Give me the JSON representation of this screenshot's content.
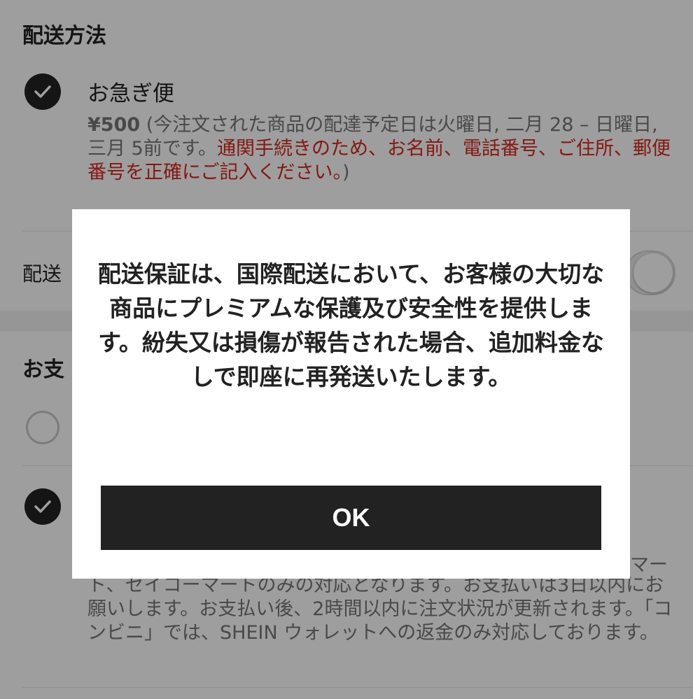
{
  "shipping": {
    "title": "配送方法",
    "option_name": "お急ぎ便",
    "price": "¥500",
    "desc_normal": " (今注文された商品の配達予定日は火曜日, 二月 28 – 日曜日, 三月 5前です。",
    "desc_warning": "通関手続きのため、お名前、電話番号、ご住所、郵便番号を正確にご記入ください。",
    "desc_end": ")",
    "guarantee_label": "配送"
  },
  "payment": {
    "title": "お支",
    "konbini_note": "ト、セイコーマートのみの対応となります。お支払いは3日以内にお願いします。お支払い後、2時間以内に注文状況が更新されます。「コンビニ」では、SHEIN ウォレットへの返金のみ対応しております。",
    "partial_prefix": "マー"
  },
  "modal": {
    "message": "配送保証は、国際配送において、お客様の大切な商品にプレミアムな保護及び安全性を提供します。紛失又は損傷が報告された場合、追加料金なしで即座に再発送いたします。",
    "ok_label": "OK"
  },
  "colors": {
    "accent": "#222222",
    "warning": "#d6281e",
    "overlay": "rgba(0,0,0,0.38)"
  },
  "icons": {
    "selected": "checkmark-icon",
    "unselected": "radio-empty-icon"
  }
}
